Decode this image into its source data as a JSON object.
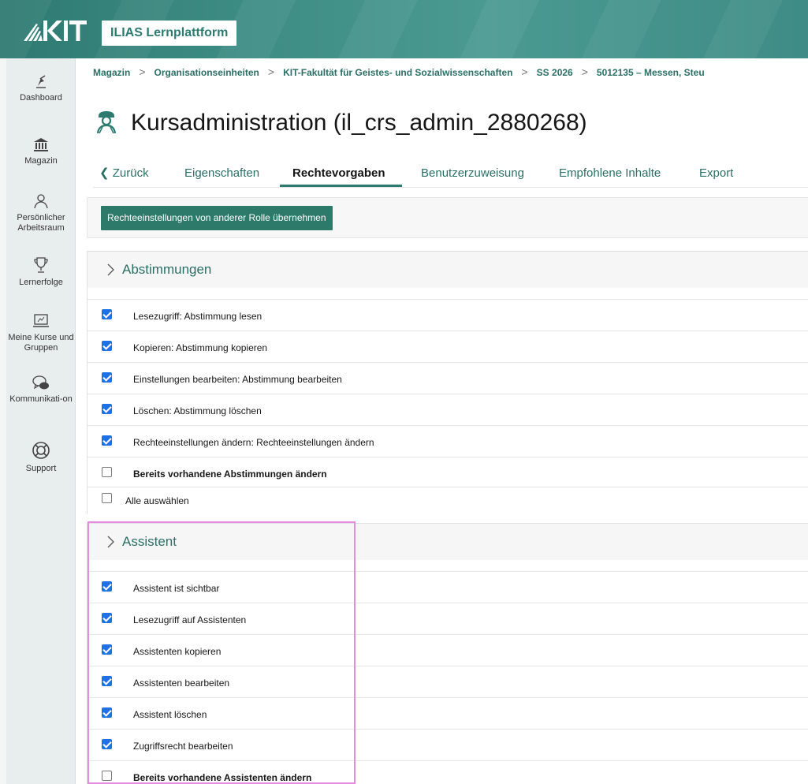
{
  "header": {
    "brand": "ILIAS Lernplattform",
    "logo_text": "KIT"
  },
  "sidebar": {
    "items": [
      {
        "label": "Dashboard",
        "icon": "dashboard-icon"
      },
      {
        "label": "Magazin",
        "icon": "library-icon"
      },
      {
        "label": "Persönlicher Arbeitsraum",
        "icon": "person-icon"
      },
      {
        "label": "Lernerfolge",
        "icon": "trophy-icon"
      },
      {
        "label": "Meine Kurse und Gruppen",
        "icon": "monitor-icon"
      },
      {
        "label": "Kommunikati-on",
        "icon": "chat-icon"
      },
      {
        "label": "Support",
        "icon": "lifebuoy-icon"
      }
    ]
  },
  "breadcrumb": {
    "items": [
      "Magazin",
      "Organisationseinheiten",
      "KIT-Fakultät für Geistes- und Sozialwissenschaften",
      "SS 2026",
      "5012135 – Messen, Steu"
    ],
    "separator": ">"
  },
  "page": {
    "title": "Kursadministration (il_crs_admin_2880268)"
  },
  "tabs": {
    "back": "Zurück",
    "items": [
      "Eigenschaften",
      "Rechtevorgaben",
      "Benutzerzuweisung",
      "Empfohlene Inhalte",
      "Export"
    ],
    "active": "Rechtevorgaben"
  },
  "toolbar": {
    "copy_button": "Rechteeinstellungen von anderer Rolle übernehmen"
  },
  "panels": [
    {
      "title": "Abstimmungen",
      "rows": [
        {
          "label": "Lesezugriff: Abstimmung lesen",
          "checked": true,
          "bold": false
        },
        {
          "label": "Kopieren: Abstimmung kopieren",
          "checked": true,
          "bold": false
        },
        {
          "label": "Einstellungen bearbeiten: Abstimmung bearbeiten",
          "checked": true,
          "bold": false
        },
        {
          "label": "Löschen: Abstimmung löschen",
          "checked": true,
          "bold": false
        },
        {
          "label": "Rechteeinstellungen ändern: Rechteeinstellungen ändern",
          "checked": true,
          "bold": false
        },
        {
          "label": "Bereits vorhandene Abstimmungen ändern",
          "checked": false,
          "bold": true
        }
      ],
      "select_all": "Alle auswählen"
    },
    {
      "title": "Assistent",
      "rows": [
        {
          "label": "Assistent ist sichtbar",
          "checked": true,
          "bold": false
        },
        {
          "label": "Lesezugriff auf Assistenten",
          "checked": true,
          "bold": false
        },
        {
          "label": "Assistenten kopieren",
          "checked": true,
          "bold": false
        },
        {
          "label": "Assistenten bearbeiten",
          "checked": true,
          "bold": false
        },
        {
          "label": "Assistent löschen",
          "checked": true,
          "bold": false
        },
        {
          "label": "Zugriffsrecht bearbeiten",
          "checked": true,
          "bold": false
        },
        {
          "label": "Bereits vorhandene Assistenten ändern",
          "checked": false,
          "bold": true
        }
      ]
    }
  ],
  "colors": {
    "brand": "#2d7a71",
    "link": "#2b6f66",
    "checkbox": "#1f72e3",
    "highlight": "#e58ce0"
  }
}
